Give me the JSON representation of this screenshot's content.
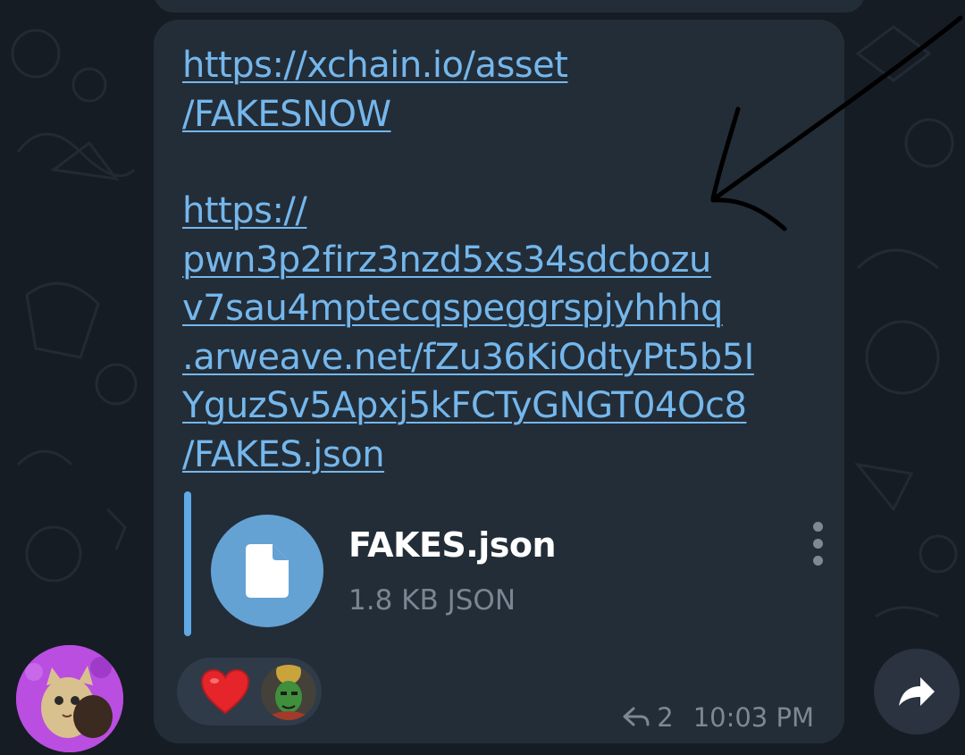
{
  "message": {
    "links": [
      {
        "lines": [
          "https://xchain.io/asset",
          "/FAKESNOW"
        ]
      },
      {
        "lines": [
          "https://",
          "pwn3p2firz3nzd5xs34sdcbozu",
          "v7sau4mptecqspeggrspjyhhhq",
          ".arweave.net/fZu36KiOdtyPt5b5I",
          "YguzSv5Apxj5kFCTyGNGT04Oc8",
          "/FAKES.json"
        ]
      }
    ],
    "file": {
      "name": "FAKES.json",
      "meta": "1.8 KB JSON",
      "icon": "file-icon"
    },
    "reactions": [
      {
        "icon": "red-heart-emoji"
      },
      {
        "icon": "user-reaction-avatar"
      }
    ],
    "reply_count": "2",
    "reply_icon": "reply-arrow-icon",
    "time": "10:03 PM"
  },
  "sender_avatar": "cat-avatar",
  "share_icon": "share-arrow-icon",
  "colors": {
    "background": "#161c24",
    "bubble": "#232d38",
    "link": "#74b7ec",
    "accent": "#5ea9e6",
    "annotation": "#000000"
  }
}
